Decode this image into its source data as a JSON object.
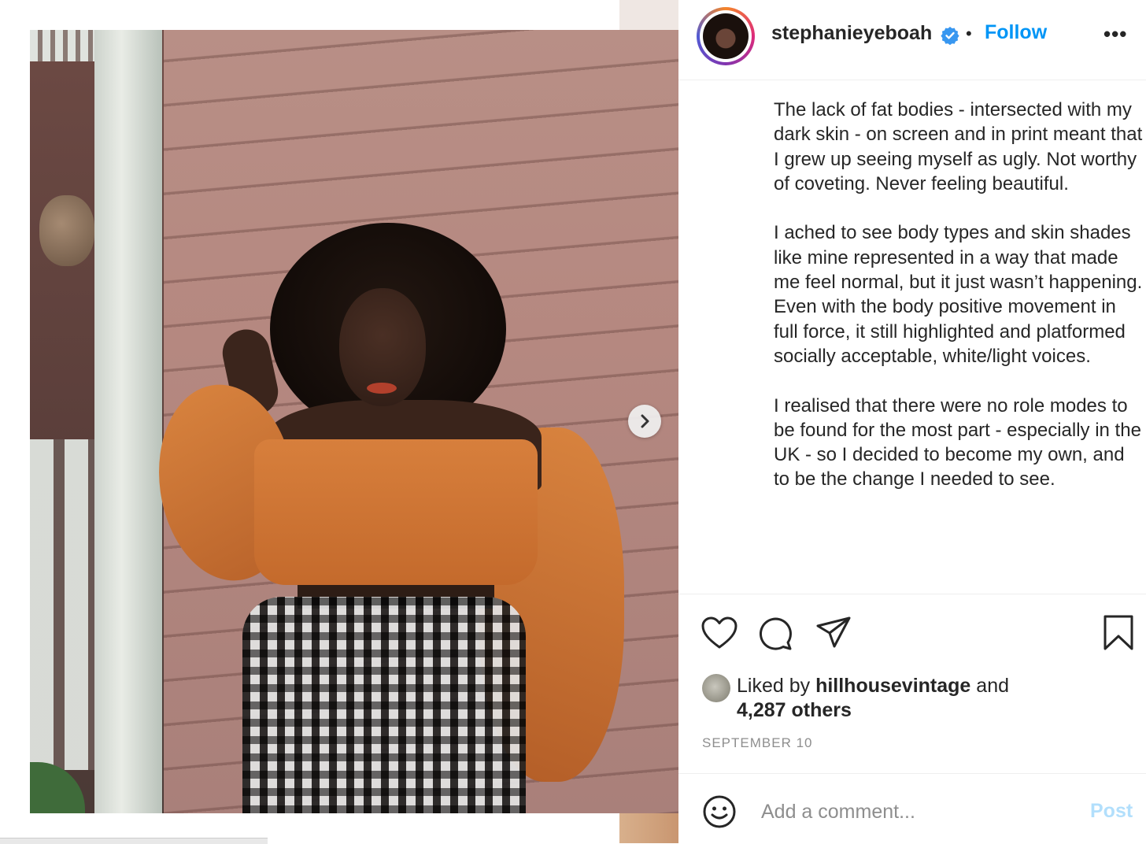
{
  "post": {
    "username": "stephanieyeboah",
    "separator": "•",
    "follow_label": "Follow",
    "more_label": "•••",
    "caption": [
      "The lack of fat bodies - intersected with my dark skin - on screen and in print meant that I grew up seeing myself as ugly. Not worthy of coveting. Never feeling beautiful.",
      "I ached to see body types and skin shades like mine represented in a way that made me feel normal, but it just wasn’t happening. Even with the body positive movement in full force, it still highlighted and platformed socially acceptable, white/light voices.",
      "I realised that there were no role modes to be found for the most part - especially in the UK - so I decided to become my own, and to be the change I needed to see."
    ],
    "liked_by_prefix": "Liked by",
    "liked_by_user": "hillhousevintage",
    "liked_by_and": "and",
    "liked_by_others": "4,287 others",
    "date": "SEPTEMBER 10",
    "comment_placeholder": "Add a comment...",
    "post_button": "Post"
  },
  "colors": {
    "accent": "#0095f6",
    "post_disabled": "#b2dffc",
    "muted": "#8e8e8e"
  },
  "icons": [
    "verified-badge-icon",
    "chevron-right-icon",
    "heart-icon",
    "comment-icon",
    "share-icon",
    "bookmark-icon",
    "emoji-icon"
  ]
}
